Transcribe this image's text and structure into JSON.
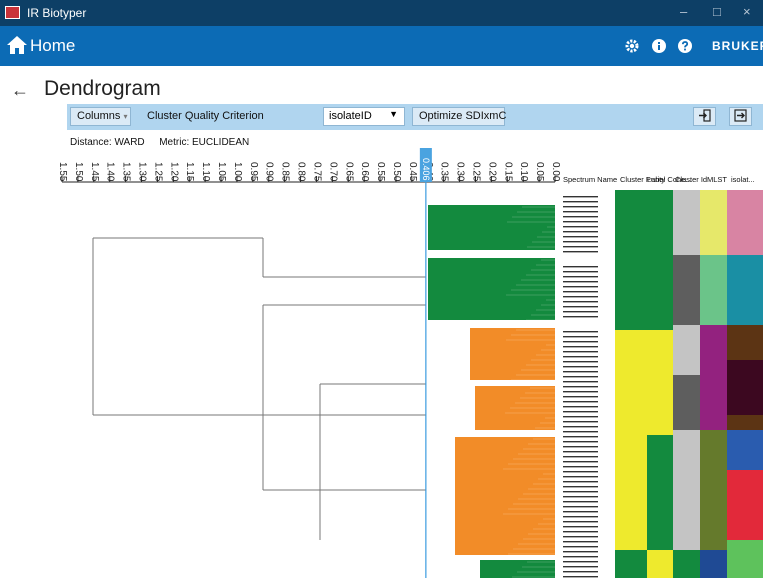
{
  "window": {
    "title": "IR Biotyper",
    "controls": [
      "–",
      "□",
      "×"
    ]
  },
  "homebar": {
    "home_label": "Home",
    "brand": "BRUKER"
  },
  "page": {
    "title": "Dendrogram",
    "back_icon": "back-arrow-icon"
  },
  "toolbar": {
    "columns_label": "Columns",
    "cqc_label": "Cluster Quality Criterion",
    "cqc_value": "isolateID",
    "optimize_label": "Optimize SDIxmC"
  },
  "info": {
    "distance": "Distance: WARD",
    "metric": "Metric: EUCLIDEAN"
  },
  "axis": {
    "ticks": [
      "1.55",
      "1.50",
      "1.45",
      "1.40",
      "1.35",
      "1.30",
      "1.25",
      "1.20",
      "1.15",
      "1.10",
      "1.05",
      "1.00",
      "0.95",
      "0.90",
      "0.85",
      "0.80",
      "0.75",
      "0.70",
      "0.65",
      "0.60",
      "0.55",
      "0.50",
      "0.45",
      "0.40",
      "0.35",
      "0.30",
      "0.25",
      "0.20",
      "0.15",
      "0.10",
      "0.05",
      "0.00"
    ],
    "cutoff_label": "0.406",
    "cutoff_value": 0.406
  },
  "columns": [
    "Spectrum Name",
    "Cluster Purity",
    "Label Cohe...",
    "Cluster Id",
    "MLST",
    "isolat..."
  ],
  "colors": {
    "green": "#138a3e",
    "orange": "#f28c28",
    "yellow": "#eeea2d",
    "light_gray": "#c4c4c4",
    "dark_gray": "#5e5e5e",
    "lime": "#e6e86a",
    "mint": "#6bc489",
    "purple": "#93227f",
    "olive": "#657a2c",
    "pink": "#d884a3",
    "teal": "#1a8fa4",
    "brown": "#5c3414",
    "maroon": "#3c0820",
    "blue": "#2a5caf",
    "red": "#e2293a",
    "lightgreen": "#5ec25c",
    "dark_blue": "#1f4a94"
  }
}
